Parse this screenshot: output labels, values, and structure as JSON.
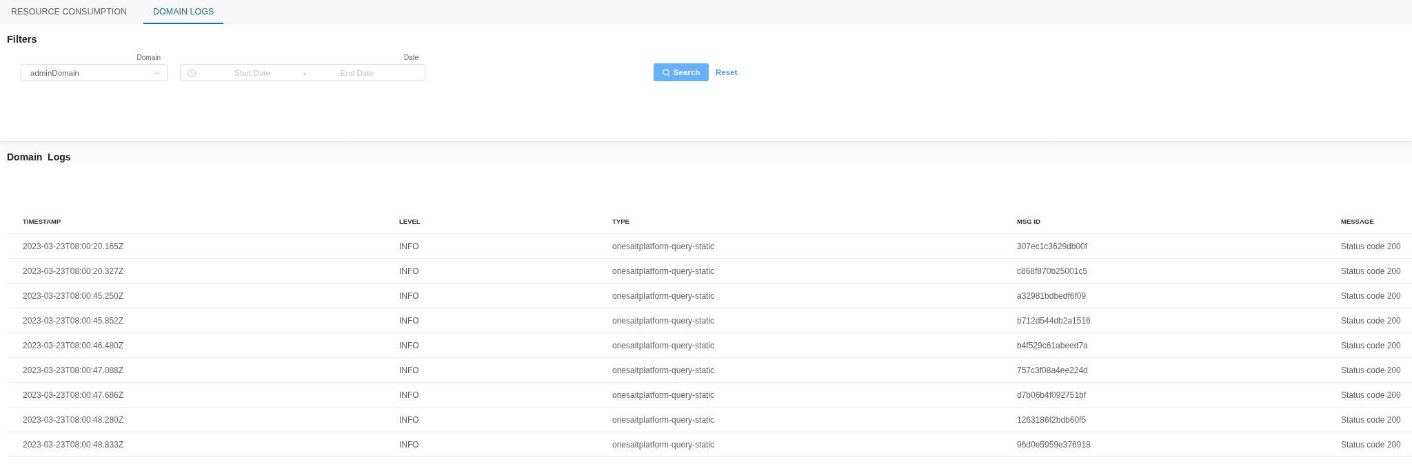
{
  "tabs": [
    {
      "label": "RESOURCE CONSUMPTION",
      "selected": false
    },
    {
      "label": "DOMAIN LOGS",
      "selected": true
    }
  ],
  "filters": {
    "title": "Filters",
    "domain": {
      "label": "Domain",
      "value": "adminDomain"
    },
    "date": {
      "label": "Date",
      "start_placeholder": "Start Date",
      "separator": "-",
      "end_placeholder": "End Date"
    },
    "search_button": "Search",
    "reset_link": "Reset"
  },
  "logs": {
    "title": "Domain  Logs",
    "table": {
      "columns": [
        "TIMESTAMP",
        "LEVEL",
        "TYPE",
        "MSG ID",
        "MESSAGE"
      ],
      "rows": [
        [
          "2023-03-23T08:00:20.165Z",
          "INFO",
          "onesaitplatform-query-static",
          "307ec1c3629db00f",
          "Status code 200"
        ],
        [
          "2023-03-23T08:00:20.327Z",
          "INFO",
          "onesaitplatform-query-static",
          "c868f870b25001c5",
          "Status code 200"
        ],
        [
          "2023-03-23T08:00:45.250Z",
          "INFO",
          "onesaitplatform-query-static",
          "a32981bdbedf6f09",
          "Status code 200"
        ],
        [
          "2023-03-23T08:00:45.852Z",
          "INFO",
          "onesaitplatform-query-static",
          "b712d544db2a1516",
          "Status code 200"
        ],
        [
          "2023-03-23T08:00:46.480Z",
          "INFO",
          "onesaitplatform-query-static",
          "b4f529c61abeed7a",
          "Status code 200"
        ],
        [
          "2023-03-23T08:00:47.088Z",
          "INFO",
          "onesaitplatform-query-static",
          "757c3f08a4ee224d",
          "Status code 200"
        ],
        [
          "2023-03-23T08:00:47.686Z",
          "INFO",
          "onesaitplatform-query-static",
          "d7b06b4f092751bf",
          "Status code 200"
        ],
        [
          "2023-03-23T08:00:48.280Z",
          "INFO",
          "onesaitplatform-query-static",
          "1263186f2bdb60f5",
          "Status code 200"
        ],
        [
          "2023-03-23T08:00:48.833Z",
          "INFO",
          "onesaitplatform-query-static",
          "96d0e5959e376918",
          "Status code 200"
        ]
      ]
    }
  }
}
